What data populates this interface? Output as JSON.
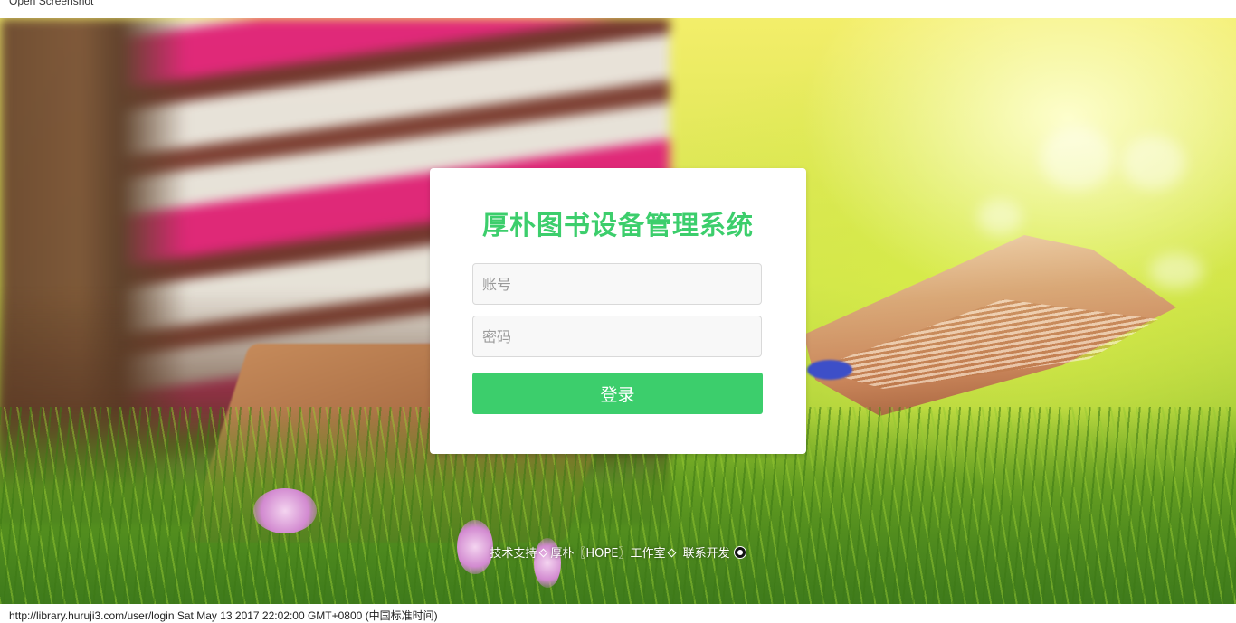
{
  "window": {
    "title": "Open Screenshot"
  },
  "login": {
    "title": "厚朴图书设备管理系统",
    "account_placeholder": "账号",
    "password_placeholder": "密码",
    "submit_label": "登录",
    "accent_color": "#3cce6c"
  },
  "footer": {
    "support_label": "技术支持",
    "studio_link": "厚朴〖HOPE〗工作室",
    "contact_link": "联系开发",
    "github_icon": "github-icon"
  },
  "status_bar": {
    "text": "http://library.huruji3.com/user/login Sat May 13 2017 22:02:00 GMT+0800 (中国标准时间)"
  }
}
